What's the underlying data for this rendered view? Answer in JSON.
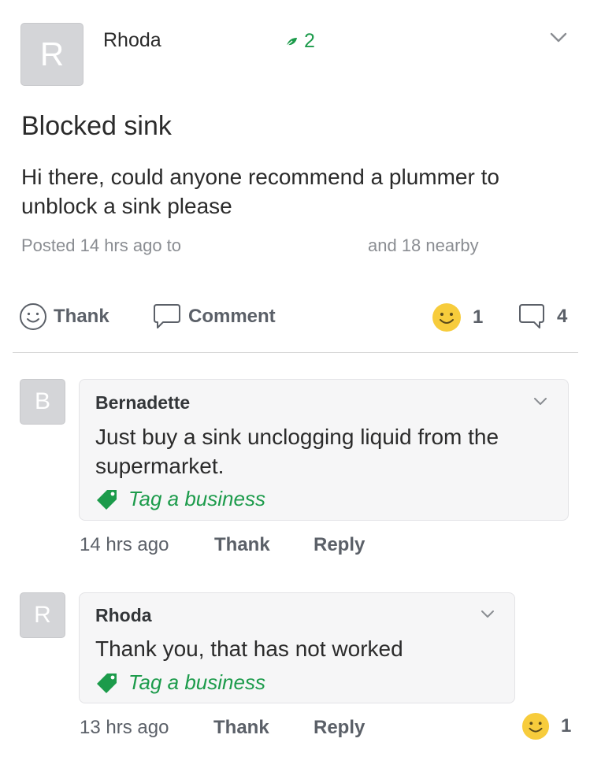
{
  "post": {
    "avatar_letter": "R",
    "author": "Rhoda",
    "leaf_count": "2",
    "title": "Blocked sink",
    "body": "Hi there, could anyone recommend a plummer to unblock a sink please",
    "posted": "Posted 14 hrs ago to",
    "nearby": "and 18 nearby",
    "thank_label": "Thank",
    "comment_label": "Comment",
    "thanks_count": "1",
    "comments_count": "4"
  },
  "comments": [
    {
      "avatar_letter": "B",
      "author": "Bernadette",
      "text": "Just buy a sink unclogging liquid from the supermarket.",
      "tag_label": "Tag a business",
      "time": "14 hrs ago",
      "thank_label": "Thank",
      "reply_label": "Reply"
    },
    {
      "avatar_letter": "R",
      "author": "Rhoda",
      "text": "Thank you, that has not worked",
      "tag_label": "Tag a business",
      "time": "13 hrs ago",
      "thank_label": "Thank",
      "reply_label": "Reply",
      "thanks_count": "1"
    }
  ],
  "colors": {
    "accent_green": "#1c9b4b",
    "emoji_yellow": "#f7cc3c",
    "avatar_gray": "#d4d5d8"
  }
}
